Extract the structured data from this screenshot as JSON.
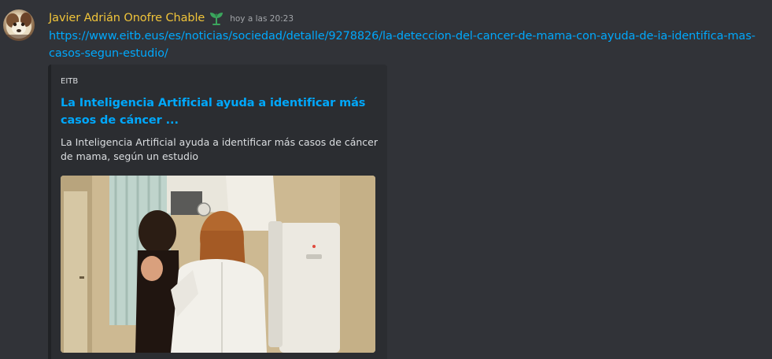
{
  "message": {
    "author": "Javier Adrián Onofre Chable",
    "timestamp": "hoy a las 20:23",
    "link_text": "https://www.eitb.eus/es/noticias/sociedad/detalle/9278826/la-deteccion-del-cancer-de-mama-con-ayuda-de-ia-identifica-mas-casos-segun-estudio/",
    "role_icon": "sprout-icon"
  },
  "embed": {
    "provider": "EITB",
    "title": "La Inteligencia Artificial ayuda a identificar más casos de cáncer ...",
    "description": "La Inteligencia Artificial ayuda a identificar más casos de cáncer de mama, según un estudio",
    "image_icon": "mammography-photo"
  },
  "colors": {
    "background": "#313338",
    "username": "#f0c43a",
    "link": "#00a8fc",
    "embed_background": "#2b2d31",
    "embed_border": "#202225",
    "role_icon": "#3ba55d"
  }
}
